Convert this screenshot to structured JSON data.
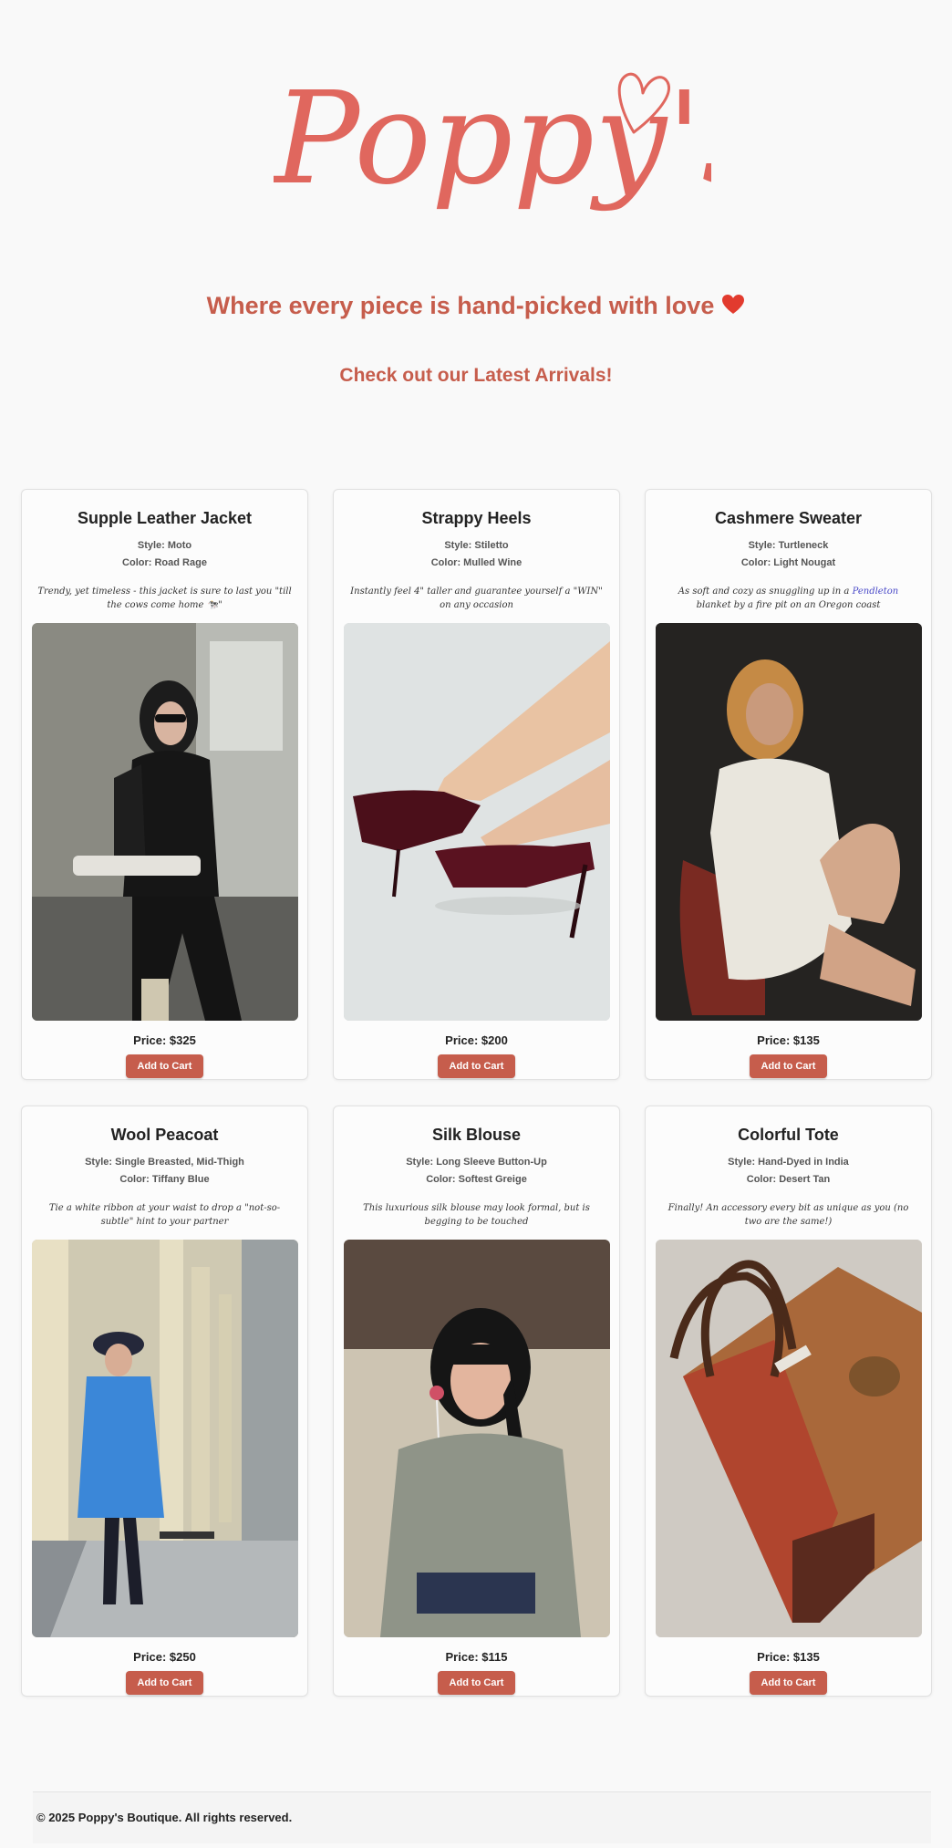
{
  "brand": {
    "logo_text": "Poppy's",
    "tagline": "Where every piece is hand-picked with love",
    "tagline_emoji": "heart-emoji",
    "subtag": "Check out our Latest Arrivals!",
    "accent_color": "#c65d4c",
    "logo_color": "#e0675e"
  },
  "products": [
    {
      "title": "Supple Leather Jacket",
      "style": "Style: Moto",
      "color": "Color: Road Rage",
      "description": "Trendy, yet timeless - this jacket is sure to last you \"till the cows come home 🐄\"",
      "price": "Price: $325",
      "button": "Add to Cart"
    },
    {
      "title": "Strappy Heels",
      "style": "Style: Stiletto",
      "color": "Color: Mulled Wine",
      "description": "Instantly feel 4\" taller and guarantee yourself a \"WIN\" on any occasion",
      "price": "Price: $200",
      "button": "Add to Cart"
    },
    {
      "title": "Cashmere Sweater",
      "style": "Style: Turtleneck",
      "color": "Color: Light Nougat",
      "description_before": "As soft and cozy as snuggling up in a ",
      "description_link": "Pendleton",
      "description_after": " blanket by a fire pit on an Oregon coast",
      "price": "Price: $135",
      "button": "Add to Cart"
    },
    {
      "title": "Wool Peacoat",
      "style": "Style: Single Breasted, Mid-Thigh",
      "color": "Color: Tiffany Blue",
      "description": "Tie a white ribbon at your waist to drop a \"not-so-subtle\" hint to your partner",
      "price": "Price: $250",
      "button": "Add to Cart"
    },
    {
      "title": "Silk Blouse",
      "style": "Style: Long Sleeve Button-Up",
      "color": "Color: Softest Greige",
      "description": "This luxurious silk blouse may look formal, but is begging to be touched",
      "price": "Price: $115",
      "button": "Add to Cart"
    },
    {
      "title": "Colorful Tote",
      "style": "Style: Hand-Dyed in India",
      "color": "Color: Desert Tan",
      "description": "Finally! An accessory every bit as unique as you (no two are the same!)",
      "price": "Price: $135",
      "button": "Add to Cart"
    }
  ],
  "footer": {
    "text": "© 2025 Poppy's Boutique. All rights reserved."
  }
}
